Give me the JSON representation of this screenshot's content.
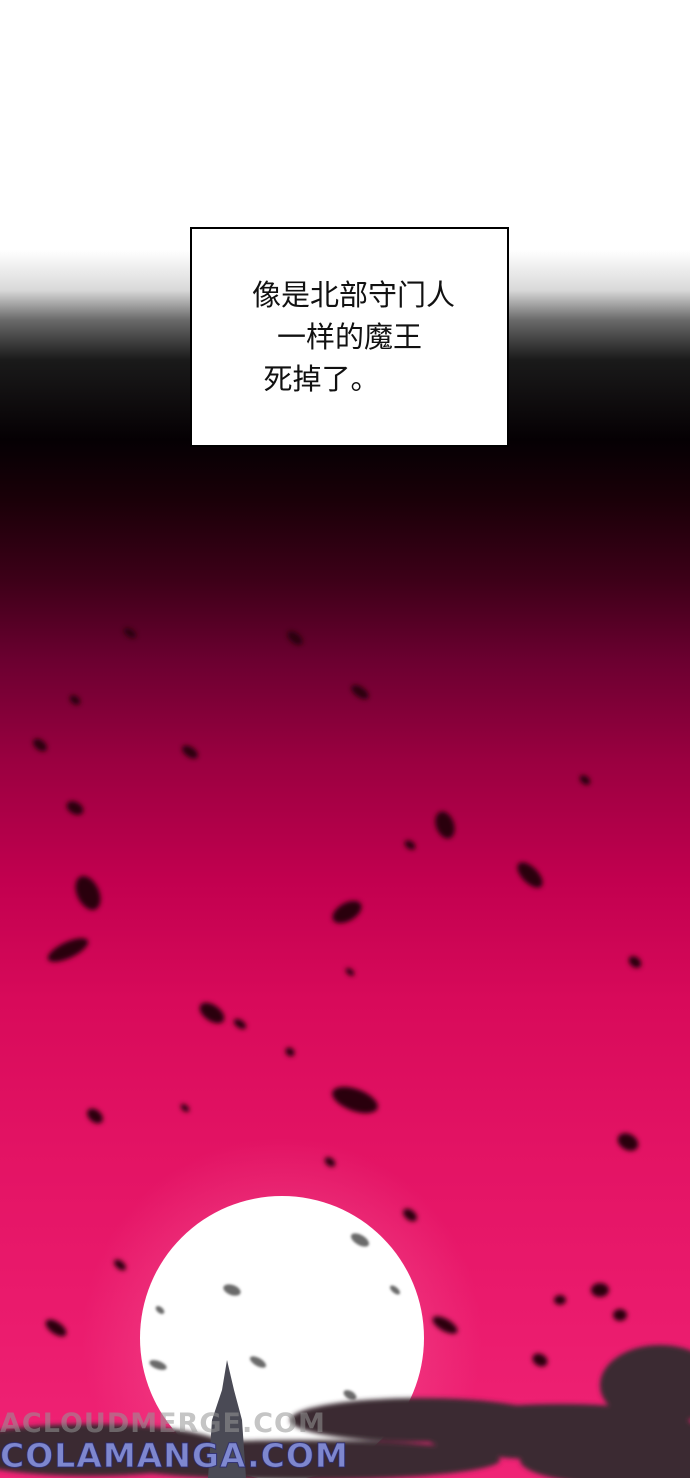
{
  "caption": {
    "lines": [
      "像是北部守门人",
      "一样的魔王",
      "死掉了。"
    ]
  },
  "watermarks": {
    "top": "ACLOUDMERGE.COM",
    "bottom": "COLAMANGA.COM"
  },
  "colors": {
    "sky_top": "#ffffff",
    "sky_dark": "#050003",
    "sky_crimson": "#d80a5a",
    "moon": "#ffffff"
  }
}
